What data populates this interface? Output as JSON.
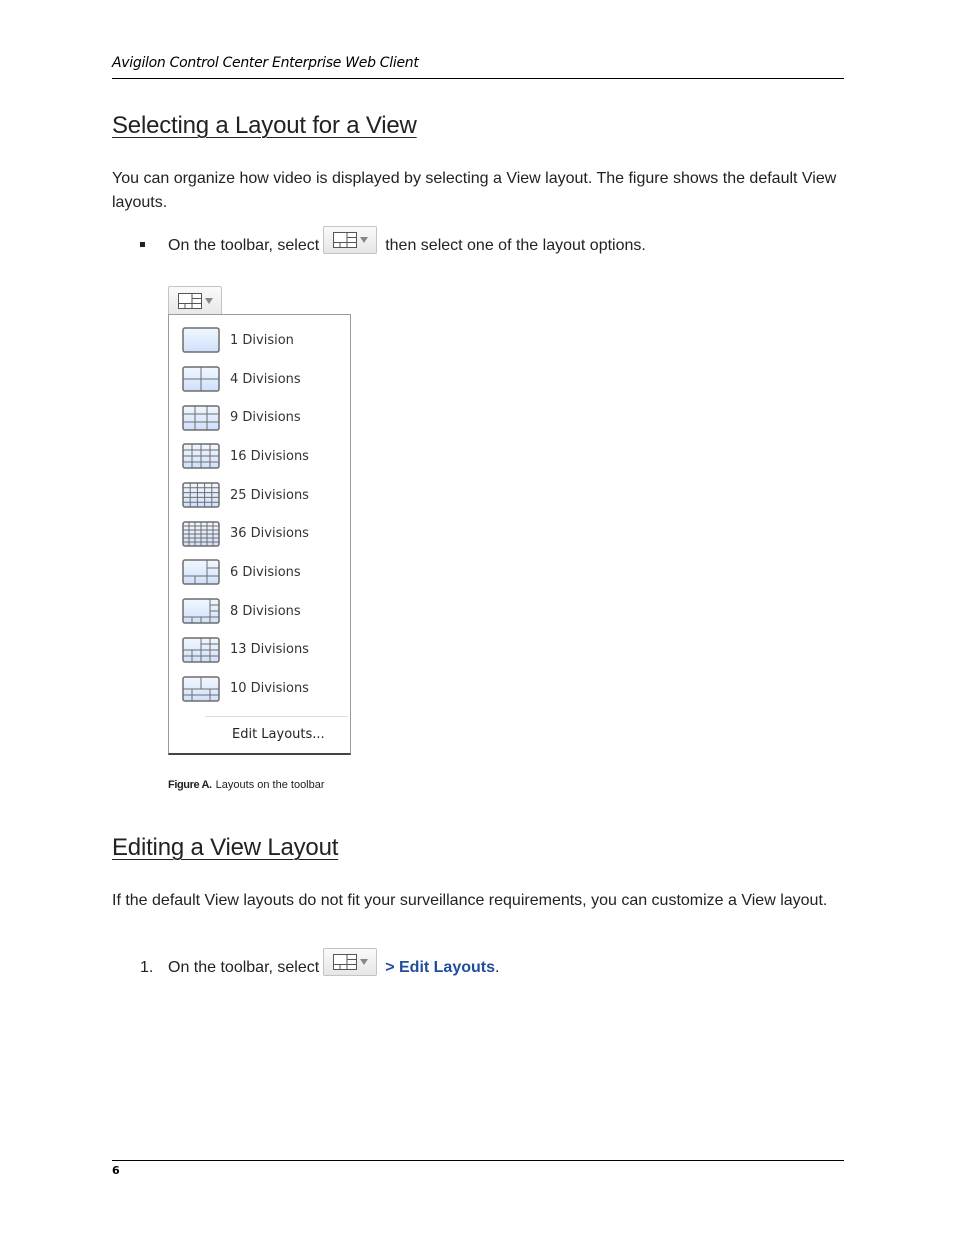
{
  "header": {
    "running_title": "Avigilon Control Center Enterprise Web Client"
  },
  "section1": {
    "title": "Selecting a Layout for a View",
    "paragraph": "You can organize how video is displayed by selecting a View layout. The figure shows the default View layouts.",
    "bullet": {
      "before": "On the toolbar, select",
      "button_icon": "layout-icon",
      "after": "then select one of the layout options."
    }
  },
  "figure": {
    "button_icon": "layout-icon",
    "menu_items": [
      {
        "label": "1 Division",
        "icon": "layout-1-icon"
      },
      {
        "label": "4 Divisions",
        "icon": "layout-4-icon"
      },
      {
        "label": "9 Divisions",
        "icon": "layout-9-icon"
      },
      {
        "label": "16 Divisions",
        "icon": "layout-16-icon"
      },
      {
        "label": "25 Divisions",
        "icon": "layout-25-icon"
      },
      {
        "label": "36 Divisions",
        "icon": "layout-36-icon"
      },
      {
        "label": "6 Divisions",
        "icon": "layout-6-icon"
      },
      {
        "label": "8 Divisions",
        "icon": "layout-8-icon"
      },
      {
        "label": "13 Divisions",
        "icon": "layout-13-icon"
      },
      {
        "label": "10 Divisions",
        "icon": "layout-10-icon"
      }
    ],
    "edit_label": "Edit Layouts...",
    "caption_label": "Figure A.",
    "caption_text": "Layouts on the toolbar"
  },
  "section2": {
    "title": "Editing a View Layout",
    "paragraph": "If the default View layouts do not fit your surveillance requirements, you can customize a View layout.",
    "step": {
      "number": "1.",
      "before": "On the toolbar, select",
      "link": "> Edit Layouts",
      "after": "."
    }
  },
  "footer": {
    "page_number": "6"
  },
  "colors": {
    "link": "#1f4e9c",
    "icon_fill": "#cfe0fb",
    "icon_stroke": "#6d6d6d"
  }
}
